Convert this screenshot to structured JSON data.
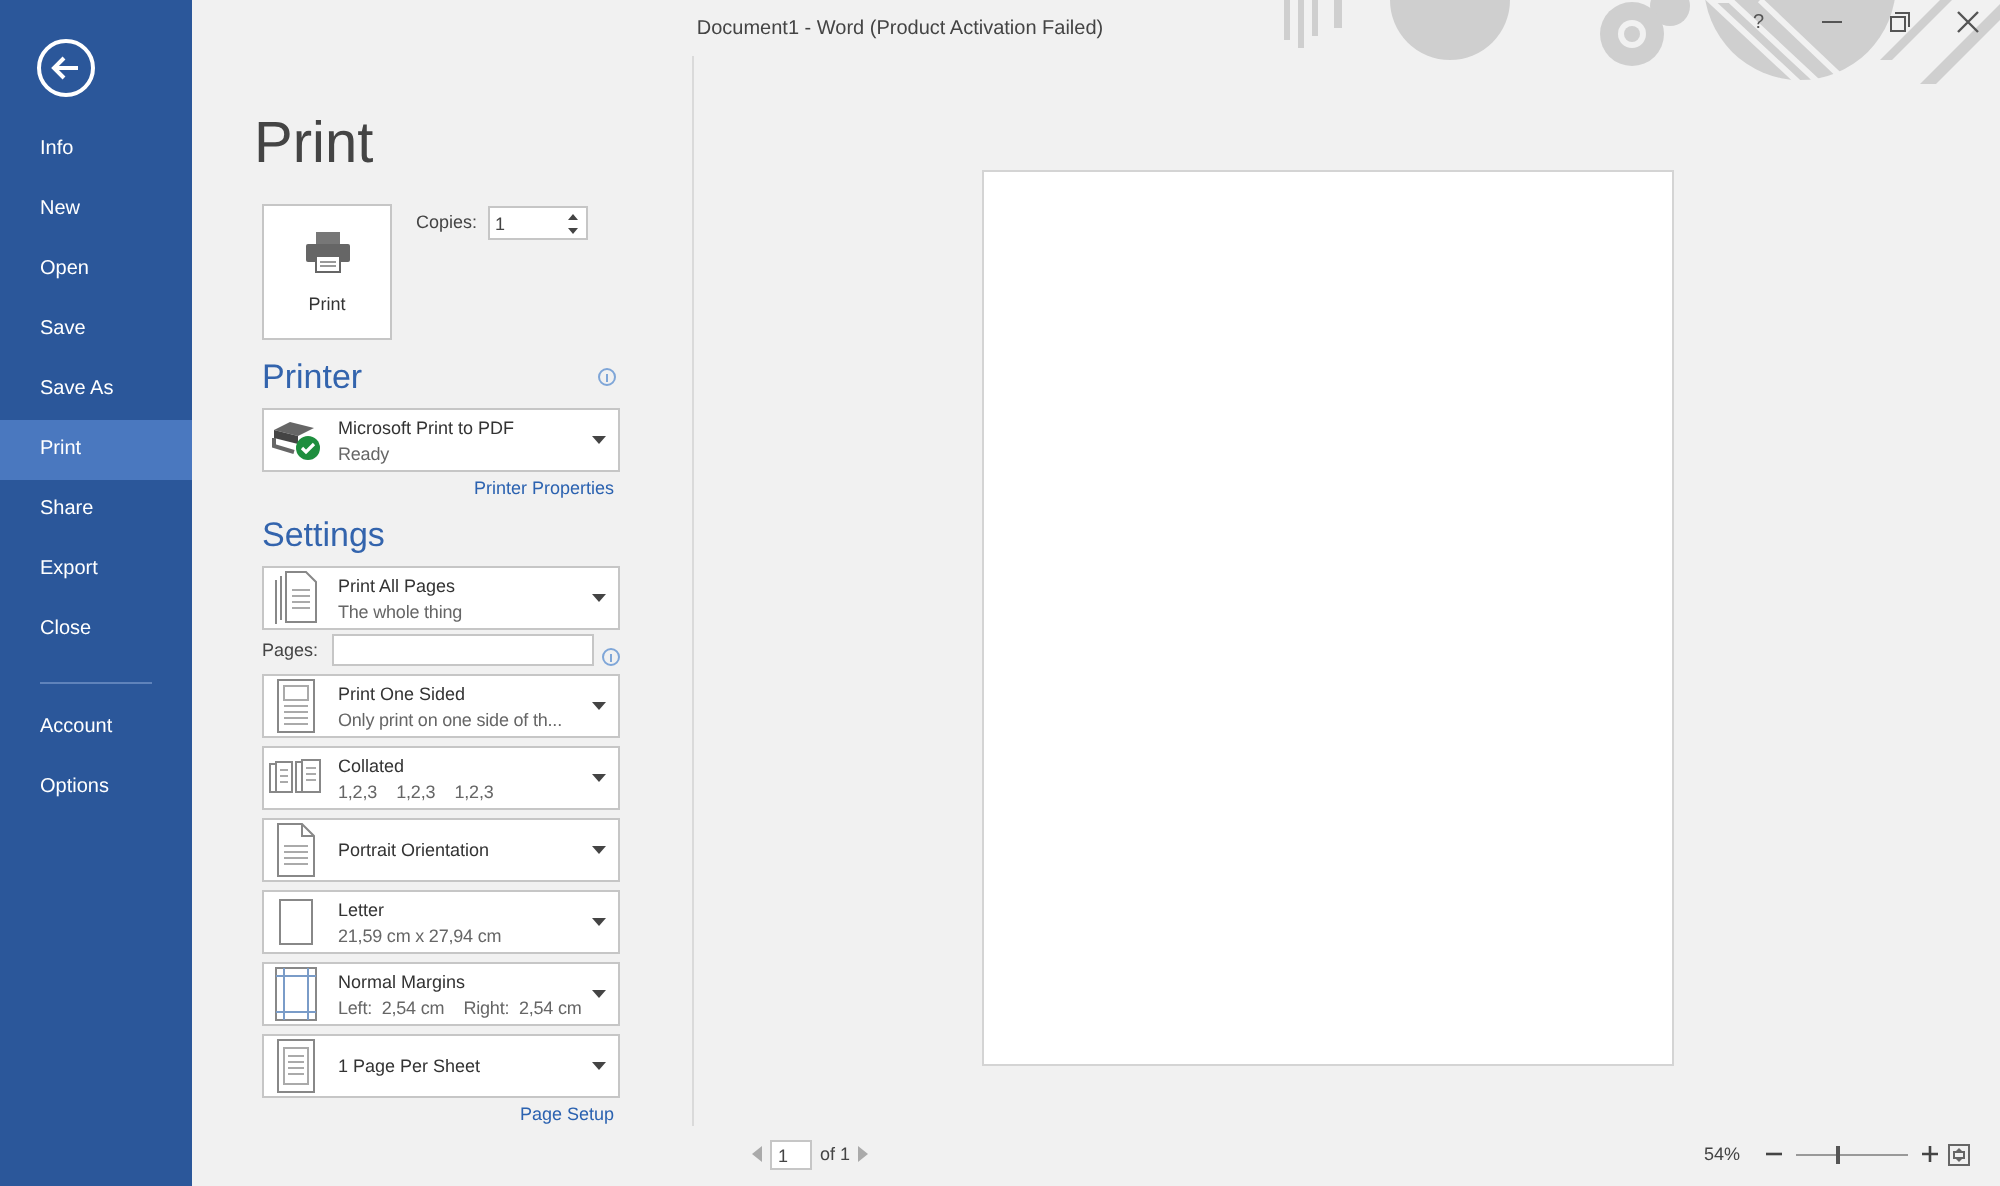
{
  "window": {
    "title": "Document1 - Word (Product Activation Failed)",
    "help": "?"
  },
  "sidebar": {
    "items": [
      {
        "label": "Info",
        "selected": false
      },
      {
        "label": "New",
        "selected": false
      },
      {
        "label": "Open",
        "selected": false
      },
      {
        "label": "Save",
        "selected": false
      },
      {
        "label": "Save As",
        "selected": false
      },
      {
        "label": "Print",
        "selected": true
      },
      {
        "label": "Share",
        "selected": false
      },
      {
        "label": "Export",
        "selected": false
      },
      {
        "label": "Close",
        "selected": false
      }
    ],
    "bottom_items": [
      {
        "label": "Account",
        "selected": false
      },
      {
        "label": "Options",
        "selected": false
      }
    ]
  },
  "print": {
    "title": "Print",
    "button": "Print",
    "copies_label": "Copies:",
    "copies": "1"
  },
  "printer": {
    "heading": "Printer",
    "name": "Microsoft Print to PDF",
    "status": "Ready",
    "properties_link": "Printer Properties"
  },
  "settings": {
    "heading": "Settings",
    "items": [
      {
        "kind": "dropdown",
        "title": "Print All Pages",
        "subtitle": "The whole thing"
      },
      {
        "kind": "field",
        "label": "Pages:"
      },
      {
        "kind": "dropdown",
        "title": "Print One Sided",
        "subtitle": "Only print on one side of th..."
      },
      {
        "kind": "dropdown",
        "title": "Collated",
        "subtitle": "1,2,3    1,2,3    1,2,3"
      },
      {
        "kind": "dropdown",
        "title": "Portrait Orientation"
      },
      {
        "kind": "dropdown",
        "title": "Letter",
        "subtitle": "21,59 cm x 27,94 cm"
      },
      {
        "kind": "dropdown",
        "title": "Normal Margins",
        "subtitle": "Left:  2,54 cm    Right:  2,54 cm"
      },
      {
        "kind": "dropdown",
        "title": "1 Page Per Sheet"
      }
    ],
    "page_setup_link": "Page Setup"
  },
  "preview": {
    "page": "1",
    "page_count": "of 1",
    "zoom": {
      "reading": "54%",
      "level": 0.35
    }
  }
}
